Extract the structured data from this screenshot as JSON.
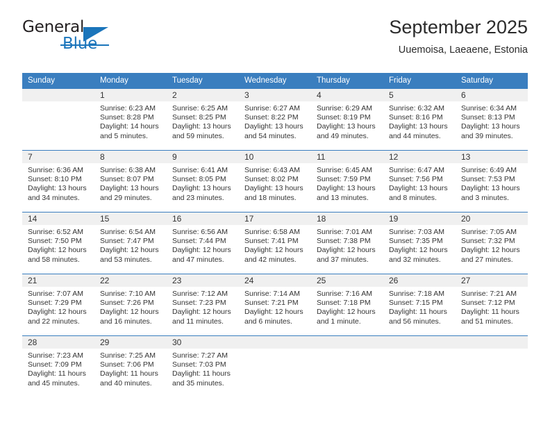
{
  "brand": {
    "name_part1": "General",
    "name_part2": "Blue",
    "logo_icon": "triangle-flag-icon",
    "accent_color": "#1b75bb"
  },
  "header": {
    "title": "September 2025",
    "subtitle": "Uuemoisa, Laeaene, Estonia"
  },
  "theme": {
    "header_row_bg": "#3a7ebf",
    "daynum_band_bg": "#f0f0f0",
    "week_divider": "#3a7ebf",
    "text": "#333333"
  },
  "weekdays": [
    "Sunday",
    "Monday",
    "Tuesday",
    "Wednesday",
    "Thursday",
    "Friday",
    "Saturday"
  ],
  "weeks": [
    [
      {
        "day": "",
        "sunrise": "",
        "sunset": "",
        "daylight1": "",
        "daylight2": "",
        "blank": true
      },
      {
        "day": "1",
        "sunrise": "Sunrise: 6:23 AM",
        "sunset": "Sunset: 8:28 PM",
        "daylight1": "Daylight: 14 hours",
        "daylight2": "and 5 minutes."
      },
      {
        "day": "2",
        "sunrise": "Sunrise: 6:25 AM",
        "sunset": "Sunset: 8:25 PM",
        "daylight1": "Daylight: 13 hours",
        "daylight2": "and 59 minutes."
      },
      {
        "day": "3",
        "sunrise": "Sunrise: 6:27 AM",
        "sunset": "Sunset: 8:22 PM",
        "daylight1": "Daylight: 13 hours",
        "daylight2": "and 54 minutes."
      },
      {
        "day": "4",
        "sunrise": "Sunrise: 6:29 AM",
        "sunset": "Sunset: 8:19 PM",
        "daylight1": "Daylight: 13 hours",
        "daylight2": "and 49 minutes."
      },
      {
        "day": "5",
        "sunrise": "Sunrise: 6:32 AM",
        "sunset": "Sunset: 8:16 PM",
        "daylight1": "Daylight: 13 hours",
        "daylight2": "and 44 minutes."
      },
      {
        "day": "6",
        "sunrise": "Sunrise: 6:34 AM",
        "sunset": "Sunset: 8:13 PM",
        "daylight1": "Daylight: 13 hours",
        "daylight2": "and 39 minutes."
      }
    ],
    [
      {
        "day": "7",
        "sunrise": "Sunrise: 6:36 AM",
        "sunset": "Sunset: 8:10 PM",
        "daylight1": "Daylight: 13 hours",
        "daylight2": "and 34 minutes."
      },
      {
        "day": "8",
        "sunrise": "Sunrise: 6:38 AM",
        "sunset": "Sunset: 8:07 PM",
        "daylight1": "Daylight: 13 hours",
        "daylight2": "and 29 minutes."
      },
      {
        "day": "9",
        "sunrise": "Sunrise: 6:41 AM",
        "sunset": "Sunset: 8:05 PM",
        "daylight1": "Daylight: 13 hours",
        "daylight2": "and 23 minutes."
      },
      {
        "day": "10",
        "sunrise": "Sunrise: 6:43 AM",
        "sunset": "Sunset: 8:02 PM",
        "daylight1": "Daylight: 13 hours",
        "daylight2": "and 18 minutes."
      },
      {
        "day": "11",
        "sunrise": "Sunrise: 6:45 AM",
        "sunset": "Sunset: 7:59 PM",
        "daylight1": "Daylight: 13 hours",
        "daylight2": "and 13 minutes."
      },
      {
        "day": "12",
        "sunrise": "Sunrise: 6:47 AM",
        "sunset": "Sunset: 7:56 PM",
        "daylight1": "Daylight: 13 hours",
        "daylight2": "and 8 minutes."
      },
      {
        "day": "13",
        "sunrise": "Sunrise: 6:49 AM",
        "sunset": "Sunset: 7:53 PM",
        "daylight1": "Daylight: 13 hours",
        "daylight2": "and 3 minutes."
      }
    ],
    [
      {
        "day": "14",
        "sunrise": "Sunrise: 6:52 AM",
        "sunset": "Sunset: 7:50 PM",
        "daylight1": "Daylight: 12 hours",
        "daylight2": "and 58 minutes."
      },
      {
        "day": "15",
        "sunrise": "Sunrise: 6:54 AM",
        "sunset": "Sunset: 7:47 PM",
        "daylight1": "Daylight: 12 hours",
        "daylight2": "and 53 minutes."
      },
      {
        "day": "16",
        "sunrise": "Sunrise: 6:56 AM",
        "sunset": "Sunset: 7:44 PM",
        "daylight1": "Daylight: 12 hours",
        "daylight2": "and 47 minutes."
      },
      {
        "day": "17",
        "sunrise": "Sunrise: 6:58 AM",
        "sunset": "Sunset: 7:41 PM",
        "daylight1": "Daylight: 12 hours",
        "daylight2": "and 42 minutes."
      },
      {
        "day": "18",
        "sunrise": "Sunrise: 7:01 AM",
        "sunset": "Sunset: 7:38 PM",
        "daylight1": "Daylight: 12 hours",
        "daylight2": "and 37 minutes."
      },
      {
        "day": "19",
        "sunrise": "Sunrise: 7:03 AM",
        "sunset": "Sunset: 7:35 PM",
        "daylight1": "Daylight: 12 hours",
        "daylight2": "and 32 minutes."
      },
      {
        "day": "20",
        "sunrise": "Sunrise: 7:05 AM",
        "sunset": "Sunset: 7:32 PM",
        "daylight1": "Daylight: 12 hours",
        "daylight2": "and 27 minutes."
      }
    ],
    [
      {
        "day": "21",
        "sunrise": "Sunrise: 7:07 AM",
        "sunset": "Sunset: 7:29 PM",
        "daylight1": "Daylight: 12 hours",
        "daylight2": "and 22 minutes."
      },
      {
        "day": "22",
        "sunrise": "Sunrise: 7:10 AM",
        "sunset": "Sunset: 7:26 PM",
        "daylight1": "Daylight: 12 hours",
        "daylight2": "and 16 minutes."
      },
      {
        "day": "23",
        "sunrise": "Sunrise: 7:12 AM",
        "sunset": "Sunset: 7:23 PM",
        "daylight1": "Daylight: 12 hours",
        "daylight2": "and 11 minutes."
      },
      {
        "day": "24",
        "sunrise": "Sunrise: 7:14 AM",
        "sunset": "Sunset: 7:21 PM",
        "daylight1": "Daylight: 12 hours",
        "daylight2": "and 6 minutes."
      },
      {
        "day": "25",
        "sunrise": "Sunrise: 7:16 AM",
        "sunset": "Sunset: 7:18 PM",
        "daylight1": "Daylight: 12 hours",
        "daylight2": "and 1 minute."
      },
      {
        "day": "26",
        "sunrise": "Sunrise: 7:18 AM",
        "sunset": "Sunset: 7:15 PM",
        "daylight1": "Daylight: 11 hours",
        "daylight2": "and 56 minutes."
      },
      {
        "day": "27",
        "sunrise": "Sunrise: 7:21 AM",
        "sunset": "Sunset: 7:12 PM",
        "daylight1": "Daylight: 11 hours",
        "daylight2": "and 51 minutes."
      }
    ],
    [
      {
        "day": "28",
        "sunrise": "Sunrise: 7:23 AM",
        "sunset": "Sunset: 7:09 PM",
        "daylight1": "Daylight: 11 hours",
        "daylight2": "and 45 minutes."
      },
      {
        "day": "29",
        "sunrise": "Sunrise: 7:25 AM",
        "sunset": "Sunset: 7:06 PM",
        "daylight1": "Daylight: 11 hours",
        "daylight2": "and 40 minutes."
      },
      {
        "day": "30",
        "sunrise": "Sunrise: 7:27 AM",
        "sunset": "Sunset: 7:03 PM",
        "daylight1": "Daylight: 11 hours",
        "daylight2": "and 35 minutes."
      },
      {
        "day": "",
        "sunrise": "",
        "sunset": "",
        "daylight1": "",
        "daylight2": "",
        "blank": true
      },
      {
        "day": "",
        "sunrise": "",
        "sunset": "",
        "daylight1": "",
        "daylight2": "",
        "blank": true
      },
      {
        "day": "",
        "sunrise": "",
        "sunset": "",
        "daylight1": "",
        "daylight2": "",
        "blank": true
      },
      {
        "day": "",
        "sunrise": "",
        "sunset": "",
        "daylight1": "",
        "daylight2": "",
        "blank": true
      }
    ]
  ]
}
